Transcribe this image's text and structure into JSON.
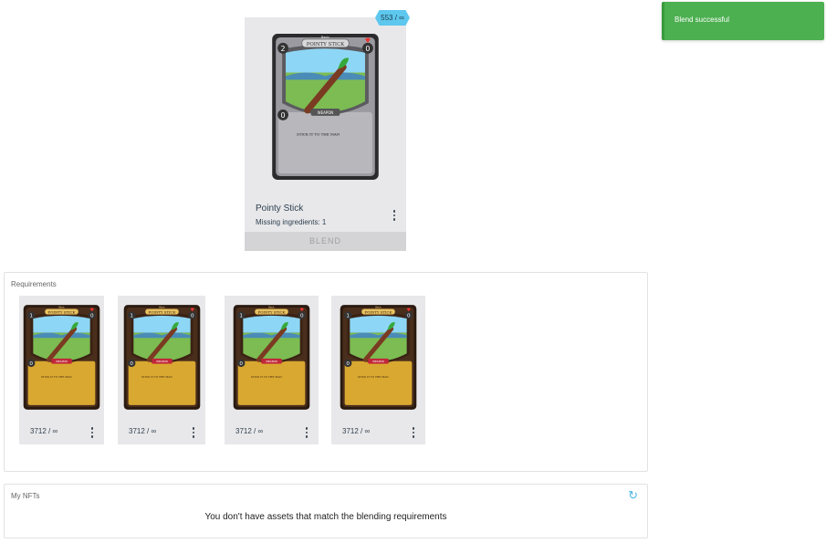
{
  "badge": "553 / ∞",
  "main_card": {
    "art_title": "POINTY STICK",
    "art_rarity": "Basic",
    "art_type": "WEAPON",
    "art_flavor": "STICK IT TO THE MAN",
    "art_attack": "2",
    "art_health": "0",
    "art_cost": "0",
    "name": "Pointy Stick",
    "missing": "Missing ingredients: 1",
    "blend_label": "BLEND",
    "frame_color": "#9a9aa0",
    "body_color": "#b8b8bc"
  },
  "toast": {
    "message": "Blend successful",
    "color": "#4caf50"
  },
  "requirements": {
    "title": "Requirements",
    "cards": [
      {
        "count": "3712 / ∞",
        "art_title": "POINTY STICK",
        "art_rarity": "Basic",
        "art_type": "WEAPON",
        "art_flavor": "STICK IT TO THE MAN",
        "art_attack": "1",
        "art_health": "0",
        "art_cost": "0"
      },
      {
        "count": "3712 / ∞",
        "art_title": "POINTY STICK",
        "art_rarity": "Basic",
        "art_type": "WEAPON",
        "art_flavor": "STICK IT TO THE MAN",
        "art_attack": "1",
        "art_health": "0",
        "art_cost": "0"
      },
      {
        "count": "3712 / ∞",
        "art_title": "POINTY STICK",
        "art_rarity": "Basic",
        "art_type": "WEAPON",
        "art_flavor": "STICK IT TO THE MAN",
        "art_attack": "1",
        "art_health": "0",
        "art_cost": "0"
      },
      {
        "count": "3712 / ∞",
        "art_title": "POINTY STICK",
        "art_rarity": "Basic",
        "art_type": "WEAPON",
        "art_flavor": "STICK IT TO THE MAN",
        "art_attack": "1",
        "art_health": "0",
        "art_cost": "0"
      }
    ],
    "frame_color": "#4a2e1c",
    "body_color": "#d9a830"
  },
  "my_nfts": {
    "title": "My NFTs",
    "empty_message": "You don't have assets that match the blending requirements",
    "refresh_icon": "refresh-icon"
  }
}
